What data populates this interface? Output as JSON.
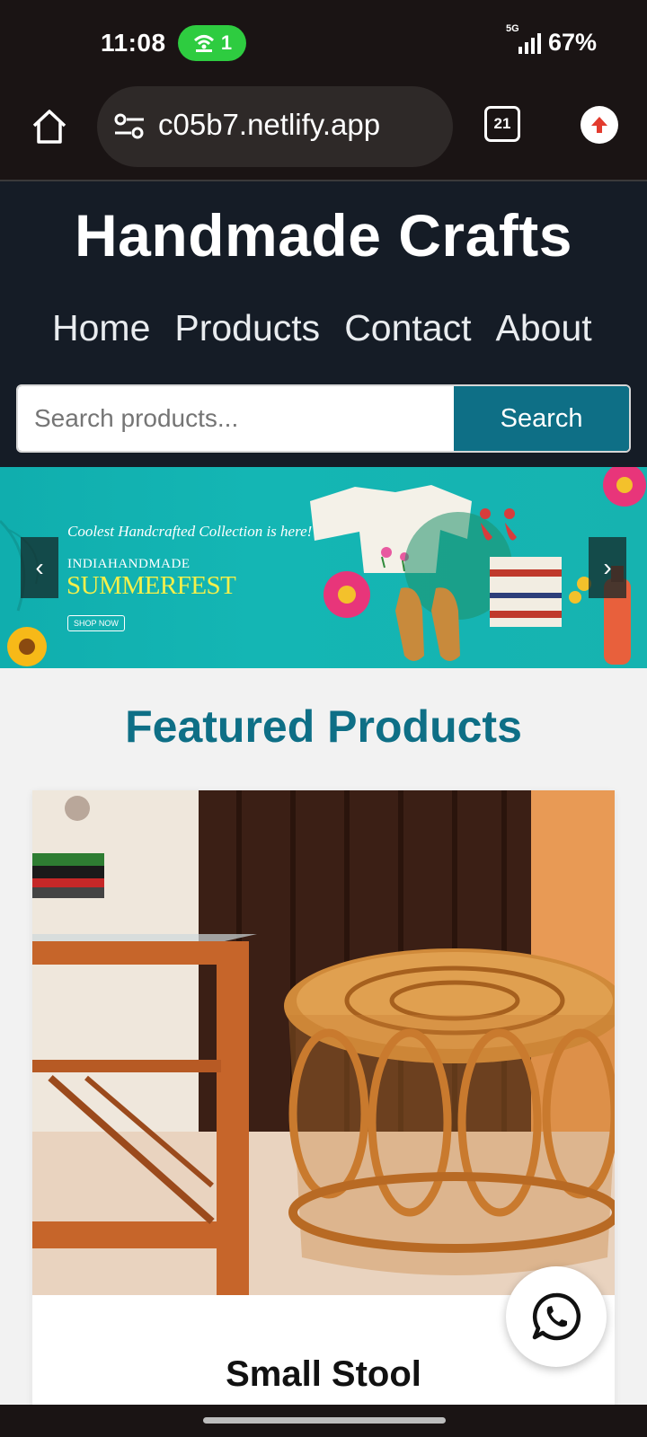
{
  "status_bar": {
    "time": "11:08",
    "hotspot_count": "1",
    "network": "5G",
    "battery": "67%"
  },
  "browser": {
    "url": "c05b7.netlify.app",
    "tab_count": "21"
  },
  "site": {
    "title": "Handmade Crafts",
    "nav": [
      "Home",
      "Products",
      "Contact",
      "About"
    ],
    "search_placeholder": "Search products...",
    "search_button": "Search"
  },
  "banner": {
    "tagline": "Coolest Handcrafted Collection is here!",
    "brand": "INDIAHANDMADE",
    "headline": "SUMMERFEST",
    "cta": "SHOP NOW",
    "prev_label": "‹",
    "next_label": "›"
  },
  "featured": {
    "title": "Featured Products",
    "products": [
      {
        "name": "Small Stool"
      }
    ]
  },
  "colors": {
    "header_bg": "#151c26",
    "accent": "#0e6f86",
    "banner_bg": "#14b6b4"
  }
}
